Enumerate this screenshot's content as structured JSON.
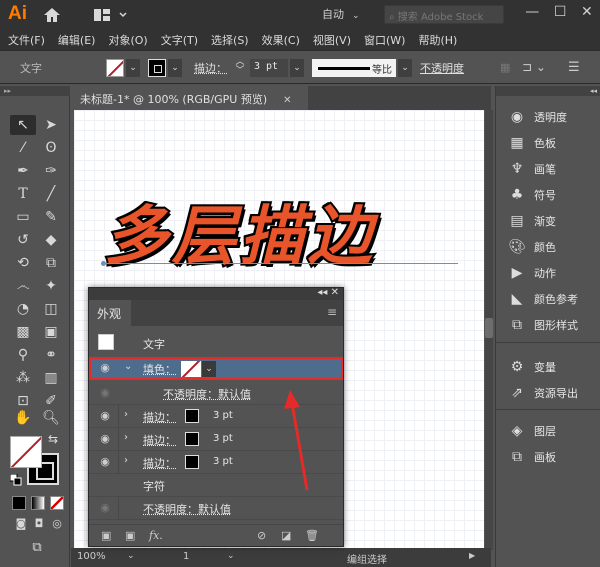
{
  "app": {
    "logo": "Ai",
    "workspace": "自动",
    "search_placeholder": "搜索 Adobe Stock",
    "window_controls": [
      "—",
      "☐",
      "✕"
    ]
  },
  "menubar": [
    "文件(F)",
    "编辑(E)",
    "对象(O)",
    "文字(T)",
    "选择(S)",
    "效果(C)",
    "视图(V)",
    "窗口(W)",
    "帮助(H)"
  ],
  "control_bar": {
    "object_type": "文字",
    "stroke_label": "描边：",
    "stroke_weight": "3 pt",
    "profile_label": "等比",
    "opacity_label": "不透明度"
  },
  "document": {
    "tab_title": "未标题-1* @ 100% (RGB/GPU 预览)",
    "close_icon": "✕",
    "artwork_text": "多层描边",
    "artwork_fill": "#e8552a",
    "artwork_stroke": "#000000"
  },
  "status_bar": {
    "zoom": "100%",
    "artboard": "1",
    "status": "编组选择"
  },
  "right_panel": {
    "group1": [
      {
        "icon": "transparency-icon",
        "label": "透明度"
      },
      {
        "icon": "swatches-icon",
        "label": "色板"
      },
      {
        "icon": "brushes-icon",
        "label": "画笔"
      },
      {
        "icon": "symbols-icon",
        "label": "符号"
      },
      {
        "icon": "gradient-icon",
        "label": "渐变"
      },
      {
        "icon": "color-icon",
        "label": "颜色"
      },
      {
        "icon": "actions-icon",
        "label": "动作"
      },
      {
        "icon": "color-guide-icon",
        "label": "颜色参考"
      },
      {
        "icon": "graphic-styles-icon",
        "label": "图形样式"
      }
    ],
    "group2": [
      {
        "icon": "variables-icon",
        "label": "变量"
      },
      {
        "icon": "asset-export-icon",
        "label": "资源导出"
      }
    ],
    "group3": [
      {
        "icon": "layers-icon",
        "label": "图层"
      },
      {
        "icon": "artboards-icon",
        "label": "画板"
      }
    ]
  },
  "appearance_panel": {
    "tab": "外观",
    "object": "文字",
    "fill": {
      "label": "填色："
    },
    "fill_opacity": "不透明度：默认值",
    "strokes": [
      {
        "label": "描边：",
        "weight": "3 pt"
      },
      {
        "label": "描边：",
        "weight": "3 pt"
      },
      {
        "label": "描边：",
        "weight": "3 pt"
      }
    ],
    "characters": "字符",
    "opacity": "不透明度：默认值",
    "fx_label": "fx."
  },
  "annotation": {
    "highlight_color": "#e52a2a",
    "arrow_color": "#e52a2a"
  }
}
